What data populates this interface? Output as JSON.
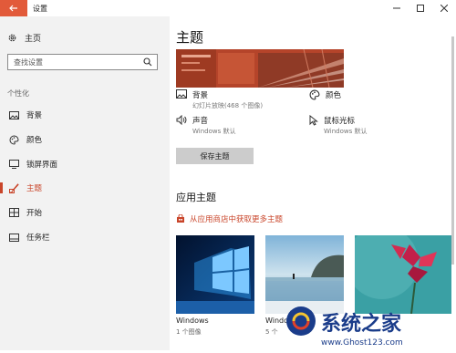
{
  "window": {
    "title": "设置"
  },
  "nav": {
    "home": "主页",
    "search_placeholder": "查找设置",
    "section": "个性化",
    "items": [
      {
        "label": "背景"
      },
      {
        "label": "颜色"
      },
      {
        "label": "锁屏界面"
      },
      {
        "label": "主题"
      },
      {
        "label": "开始"
      },
      {
        "label": "任务栏"
      }
    ]
  },
  "main": {
    "title": "主题",
    "props": [
      {
        "label": "背景",
        "value": "幻灯片放映(468 个图像)",
        "icon": "image-icon"
      },
      {
        "label": "颜色",
        "value": "",
        "icon": "palette-icon"
      },
      {
        "label": "声音",
        "value": "Windows 默认",
        "icon": "speaker-icon"
      },
      {
        "label": "鼠标光标",
        "value": "Windows 默认",
        "icon": "cursor-icon"
      }
    ],
    "save_label": "保存主题",
    "apply_title": "应用主题",
    "store_link": "从应用商店中获取更多主题",
    "themes": [
      {
        "name": "Windows",
        "count": "1 个图像"
      },
      {
        "name": "Windo",
        "count": "5 个"
      },
      {
        "name": "",
        "count": ""
      }
    ]
  },
  "watermark": {
    "brand": "系统之家",
    "url": "www.Ghost123.com"
  },
  "colors": {
    "accent": "#c9452a",
    "back_button": "#e25a3a",
    "nav_bg": "#f2f2f2"
  }
}
